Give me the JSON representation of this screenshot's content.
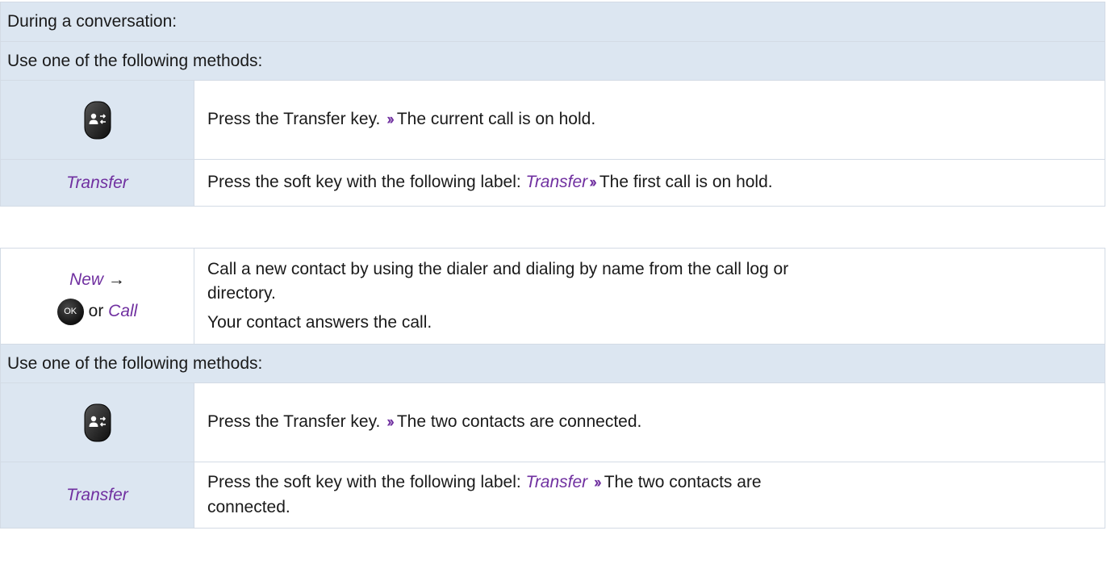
{
  "section1": {
    "header1": "During a conversation:",
    "header2": "Use one of the following methods:",
    "row1": {
      "icon": "transfer-key-icon",
      "text_before": "Press the Transfer key.",
      "chevron": "››",
      "text_after": "The current call is on hold."
    },
    "row2": {
      "softkey_label": "Transfer",
      "text_before": "Press the soft key with the following label:",
      "label": "Transfer",
      "chevron": "››",
      "text_after": "The first call is on hold."
    }
  },
  "section2": {
    "row1": {
      "new_label": "New",
      "arrow": "→",
      "ok_label": "OK",
      "or": "or",
      "call_label": "Call",
      "line1": "Call a new contact by using the dialer and dialing by name from the call log or",
      "line2": "directory.",
      "line3": "Your contact answers the call."
    },
    "header": "Use one of the following methods:",
    "row2": {
      "icon": "transfer-key-icon",
      "text_before": "Press the Transfer key.",
      "chevron": "››",
      "text_after": "The two contacts are connected."
    },
    "row3": {
      "softkey_label": "Transfer",
      "text_before": "Press the soft key with the following label:",
      "label": "Transfer",
      "chevron": "››",
      "line1_after": "The two contacts are",
      "line2": "connected."
    }
  },
  "colors": {
    "header_bg": "#dce6f1",
    "border": "#d3dbe5",
    "accent": "#7030a0"
  }
}
